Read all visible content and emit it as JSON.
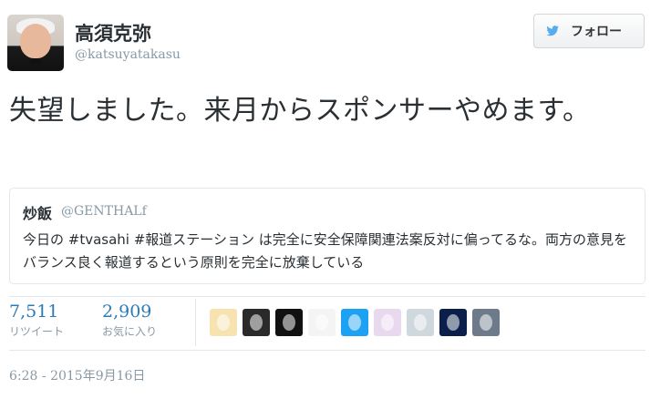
{
  "tweet": {
    "author_name": "高須克弥",
    "handle": "@katsuyatakasu",
    "follow_label": "フォロー",
    "text": "失望しました。来月からスポンサーやめます。",
    "timestamp": "6:28 - 2015年9月16日"
  },
  "quote": {
    "author_name": "炒飯",
    "handle": "@GENTHALf",
    "text": "今日の #tvasahi #報道ステーション は完全に安全保障関連法案反対に偏ってるな。両方の意見をバランス良く報道するという原則を完全に放棄している"
  },
  "stats": {
    "retweets_count": "7,511",
    "retweets_label": "リツイート",
    "favorites_count": "2,909",
    "favorites_label": "お気に入り"
  },
  "favoriters": [
    {
      "icon": "egg-bird-avatar",
      "color": "#f6e3b0"
    },
    {
      "icon": "black-cat-avatar",
      "color": "#2a2a2a"
    },
    {
      "icon": "pink-symbol-avatar",
      "color": "#111111"
    },
    {
      "icon": "sketch-avatar",
      "color": "#f4f4f4"
    },
    {
      "icon": "default-egg-avatar",
      "color": "#1da1f2"
    },
    {
      "icon": "anime-girl-avatar",
      "color": "#e8d9ef"
    },
    {
      "icon": "snorlax-avatar",
      "color": "#cfd8dc"
    },
    {
      "icon": "night-flag-avatar",
      "color": "#0b1f4a"
    },
    {
      "icon": "racer-avatar",
      "color": "#6c7a89"
    }
  ],
  "colors": {
    "link": "#2b7bb9",
    "muted": "#8899a6",
    "text": "#292f33",
    "border": "#e1e8ed"
  }
}
